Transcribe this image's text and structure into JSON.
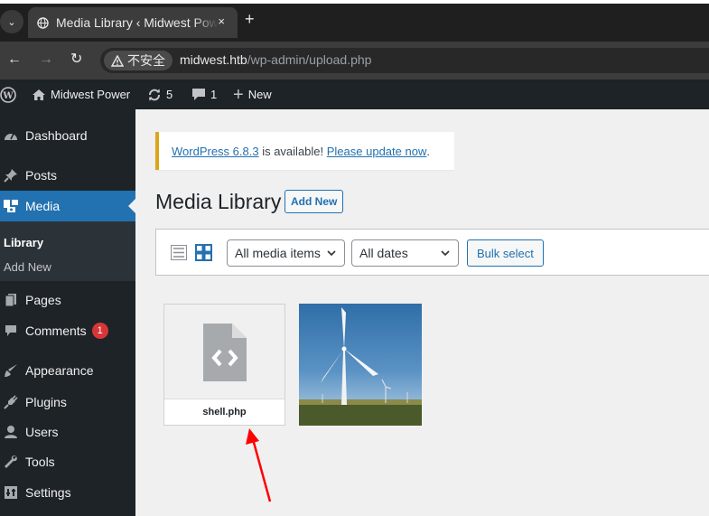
{
  "browser": {
    "tab_title": "Media Library ‹ Midwest Power — WordPress",
    "tab_close": "×",
    "new_tab": "+",
    "security_label": "不安全",
    "url_host": "midwest.htb",
    "url_path": "/wp-admin/upload.php"
  },
  "adminbar": {
    "site_name": "Midwest Power",
    "updates_count": "5",
    "comments_count": "1",
    "new_label": "New"
  },
  "sidebar": {
    "items": [
      {
        "label": "Dashboard",
        "icon": "dashboard-icon"
      },
      {
        "label": "Posts",
        "icon": "pin-icon"
      },
      {
        "label": "Media",
        "icon": "media-icon"
      },
      {
        "label": "Pages",
        "icon": "pages-icon"
      },
      {
        "label": "Comments",
        "icon": "comment-icon",
        "badge": "1"
      },
      {
        "label": "Appearance",
        "icon": "brush-icon"
      },
      {
        "label": "Plugins",
        "icon": "plug-icon"
      },
      {
        "label": "Users",
        "icon": "user-icon"
      },
      {
        "label": "Tools",
        "icon": "wrench-icon"
      },
      {
        "label": "Settings",
        "icon": "settings-icon"
      }
    ],
    "submenu": [
      {
        "label": "Library",
        "current": true
      },
      {
        "label": "Add New",
        "current": false
      }
    ]
  },
  "notice": {
    "version_link": "WordPress 6.8.3",
    "middle_text": " is available! ",
    "update_link": "Please update now",
    "end_text": "."
  },
  "main": {
    "title": "Media Library",
    "add_new": "Add New",
    "filter_type": "All media items",
    "filter_date": "All dates",
    "bulk_select": "Bulk select"
  },
  "attachments": [
    {
      "filename": "shell.php",
      "type": "code-file"
    },
    {
      "type": "image",
      "subject": "wind-turbine"
    }
  ],
  "colors": {
    "admin_dark": "#1d2327",
    "wp_blue": "#2271b1",
    "notice_warning": "#dba617",
    "badge_red": "#d63638",
    "annotation_arrow": "#ff0000"
  }
}
